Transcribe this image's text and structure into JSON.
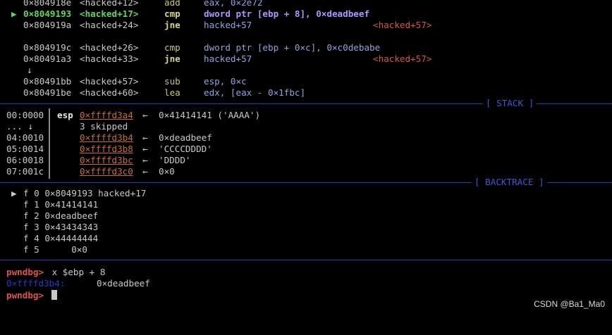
{
  "disasm": [
    {
      "addr": "0×804918e",
      "fn": "<hacked+12>",
      "op": "add",
      "arg": "eax, 0×2e72",
      "tgt": ""
    },
    {
      "addr": "0×8049193",
      "fn": "<hacked+17>",
      "op": "cmp",
      "arg": "dword ptr [ebp + 8], 0×deadbeef",
      "tgt": "",
      "current": true,
      "marker": "▶"
    },
    {
      "addr": "0×804919a",
      "fn": "<hacked+24>",
      "op": "jne",
      "arg": "hacked+57",
      "tgt": "<hacked+57>"
    },
    {
      "addr": "0×804919c",
      "fn": "<hacked+26>",
      "op": "cmp",
      "arg": "dword ptr [ebp + 0×c], 0×c0debabe",
      "tgt": ""
    },
    {
      "addr": "0×80491a3",
      "fn": "<hacked+33>",
      "op": "jne",
      "arg": "hacked+57",
      "tgt": "<hacked+57>"
    },
    {
      "addr": "0×80491bb",
      "fn": "<hacked+57>",
      "op": "sub",
      "arg": "esp, 0×c",
      "tgt": ""
    },
    {
      "addr": "0×80491be",
      "fn": "<hacked+60>",
      "op": "lea",
      "arg": "edx, [eax - 0×1fbc]",
      "tgt": ""
    }
  ],
  "down_arrow": "↓",
  "sections": {
    "stack": "[ STACK ]",
    "backtrace": "[ BACKTRACE ]"
  },
  "stack": [
    {
      "idx": "00:0000",
      "reg": "esp",
      "addr": "0×ffffd3a4",
      "arrow": "←",
      "val": "0×41414141 ('AAAA')"
    },
    {
      "idx": "... ↓",
      "reg": "",
      "addr": "",
      "arrow": "",
      "val": "3 skipped"
    },
    {
      "idx": "04:0010",
      "reg": "",
      "addr": "0×ffffd3b4",
      "arrow": "←",
      "val": "0×deadbeef"
    },
    {
      "idx": "05:0014",
      "reg": "",
      "addr": "0×ffffd3b8",
      "arrow": "←",
      "val": "'CCCCDDDD'"
    },
    {
      "idx": "06:0018",
      "reg": "",
      "addr": "0×ffffd3bc",
      "arrow": "←",
      "val": "'DDDD'"
    },
    {
      "idx": "07:001c",
      "reg": "",
      "addr": "0×ffffd3c0",
      "arrow": "←",
      "val": "0×0"
    }
  ],
  "backtrace": [
    {
      "marker": "▶",
      "text": "f 0 0×8049193 hacked+17"
    },
    {
      "marker": "",
      "text": "f 1 0×41414141"
    },
    {
      "marker": "",
      "text": "f 2 0×deadbeef"
    },
    {
      "marker": "",
      "text": "f 3 0×43434343"
    },
    {
      "marker": "",
      "text": "f 4 0×44444444"
    },
    {
      "marker": "",
      "text": "f 5      0×0"
    }
  ],
  "console": {
    "prompt": "pwndbg>",
    "command": " x $ebp + 8",
    "result_addr": "0×ffffd3b4:",
    "result_val": "0×deadbeef"
  },
  "watermark": "CSDN @Ba1_Ma0"
}
